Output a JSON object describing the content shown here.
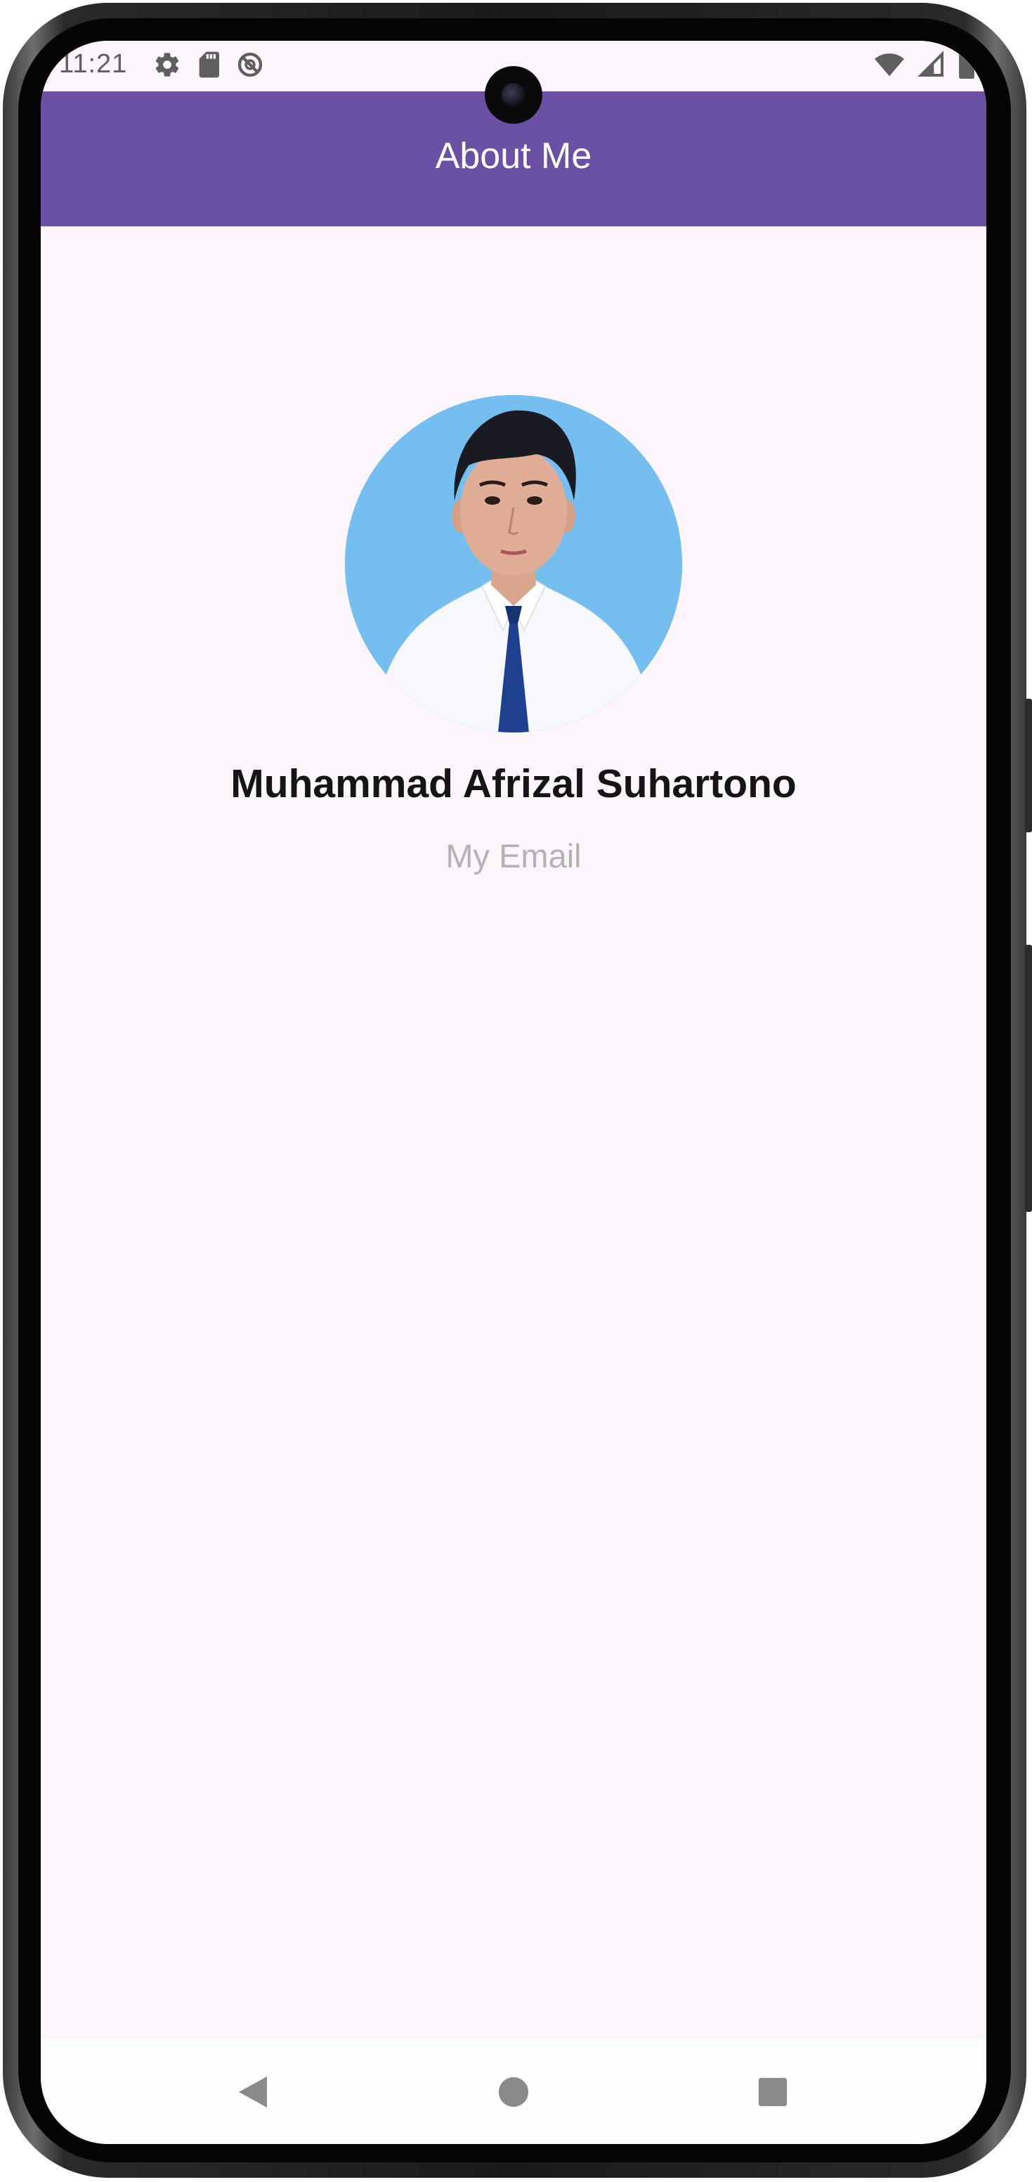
{
  "status_bar": {
    "time": "11:21",
    "left_icons": [
      "gear-icon",
      "sd-card-icon",
      "data-saver-icon"
    ],
    "right_icons": [
      "wifi-icon",
      "cell-signal-icon",
      "battery-icon"
    ]
  },
  "app_bar": {
    "title": "About Me",
    "background_color": "#6a51a3"
  },
  "profile": {
    "avatar": "profile-photo",
    "name": "Muhammad Afrizal Suhartono",
    "email_label": "My Email"
  },
  "navigation_bar": {
    "buttons": [
      "back-icon",
      "home-icon",
      "recents-icon"
    ]
  },
  "colors": {
    "background": "#fcf5fc",
    "accent": "#6a51a3",
    "secondary_text": "#b3b3b3"
  }
}
